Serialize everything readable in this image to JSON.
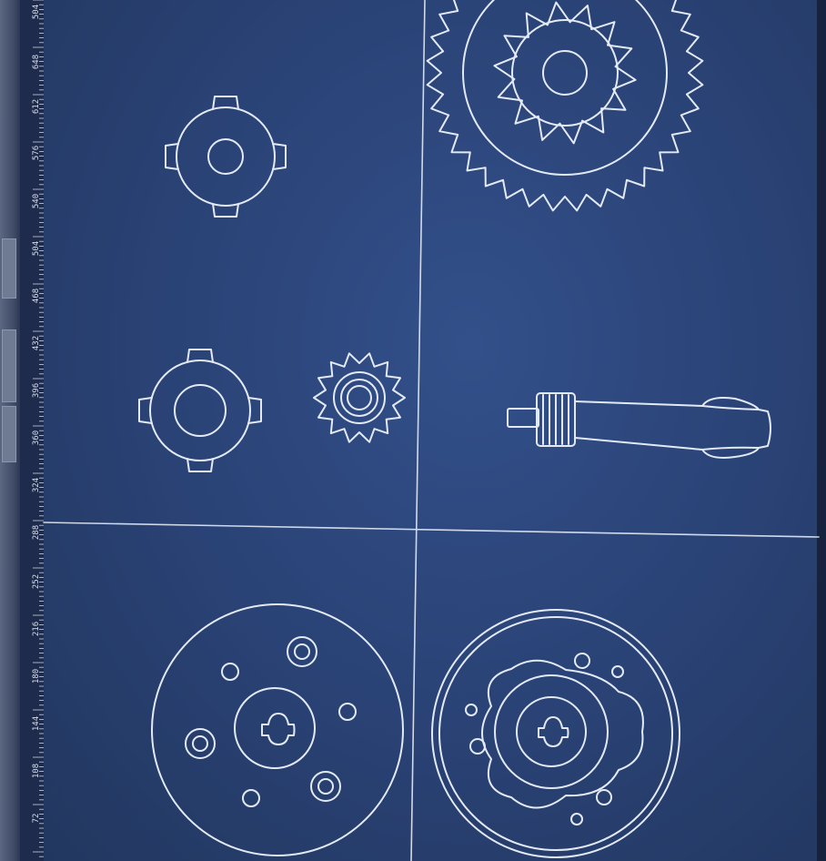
{
  "ruler": {
    "labels": [
      "504",
      "648",
      "612",
      "576",
      "540",
      "504",
      "468",
      "432",
      "396",
      "360",
      "324",
      "288",
      "252",
      "216",
      "180",
      "144",
      "108",
      "72"
    ]
  },
  "colors": {
    "canvas": "#2b4478",
    "line": "#e4eaf5"
  },
  "drawing": {
    "parts": [
      "spline-coupler",
      "large-gear",
      "spline-hub",
      "small-pinion",
      "pinion-shaft",
      "bolt-flange",
      "lobed-flange"
    ]
  }
}
